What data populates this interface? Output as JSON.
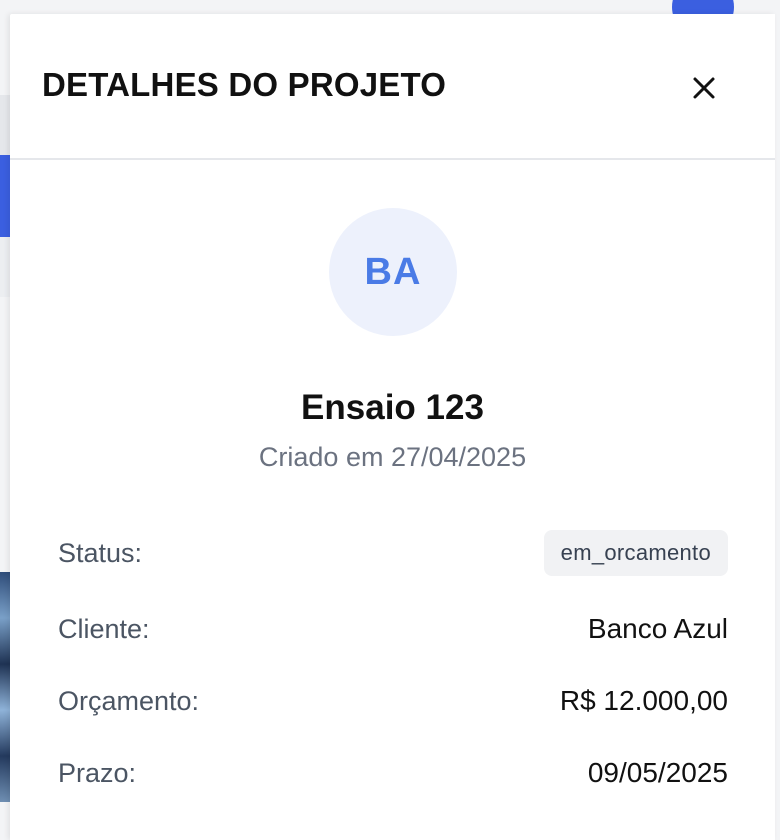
{
  "drawer": {
    "title": "DETALHES DO PROJETO",
    "close_icon": "close-icon"
  },
  "project": {
    "initials": "BA",
    "name": "Ensaio 123",
    "created_at": "Criado em 27/04/2025"
  },
  "details": {
    "status": {
      "label": "Status:",
      "value": "em_orcamento"
    },
    "cliente": {
      "label": "Cliente:",
      "value": "Banco Azul"
    },
    "orcamento": {
      "label": "Orçamento:",
      "value": "R$ 12.000,00"
    },
    "prazo": {
      "label": "Prazo:",
      "value": "09/05/2025"
    }
  },
  "colors": {
    "accent": "#3b5fe0",
    "avatar_bg": "#edf1fc",
    "avatar_text": "#4a7be6",
    "badge_bg": "#f1f2f4",
    "muted_text": "#6b7280"
  }
}
